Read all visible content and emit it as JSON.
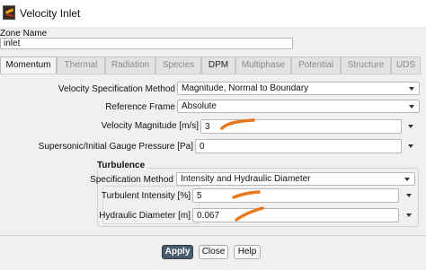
{
  "window": {
    "title": "Velocity Inlet"
  },
  "zone": {
    "label": "Zone Name",
    "value": "inlet"
  },
  "tabs": [
    {
      "label": "Momentum",
      "state": "active"
    },
    {
      "label": "Thermal",
      "state": "disabled"
    },
    {
      "label": "Radiation",
      "state": "disabled"
    },
    {
      "label": "Species",
      "state": "disabled"
    },
    {
      "label": "DPM",
      "state": "enabled"
    },
    {
      "label": "Multiphase",
      "state": "disabled"
    },
    {
      "label": "Potential",
      "state": "disabled"
    },
    {
      "label": "Structure",
      "state": "disabled"
    },
    {
      "label": "UDS",
      "state": "disabled"
    }
  ],
  "momentum": {
    "velocity_spec": {
      "label": "Velocity Specification Method",
      "value": "Magnitude, Normal to Boundary"
    },
    "reference_frame": {
      "label": "Reference Frame",
      "value": "Absolute"
    },
    "velocity_magnitude": {
      "label": "Velocity Magnitude [m/s]",
      "value": "3"
    },
    "gauge_pressure": {
      "label": "Supersonic/Initial Gauge Pressure [Pa]",
      "value": "0"
    }
  },
  "turbulence": {
    "title": "Turbulence",
    "spec_method": {
      "label": "Specification Method",
      "value": "Intensity and Hydraulic Diameter"
    },
    "intensity": {
      "label": "Turbulent Intensity [%]",
      "value": "5"
    },
    "hydraulic_diameter": {
      "label": "Hydraulic Diameter [m]",
      "value": "0.067"
    }
  },
  "buttons": {
    "apply": "Apply",
    "close": "Close",
    "help": "Help"
  },
  "annotation_color": "#e8781e",
  "icons": [
    "app-icon",
    "chevron-down-icon"
  ]
}
